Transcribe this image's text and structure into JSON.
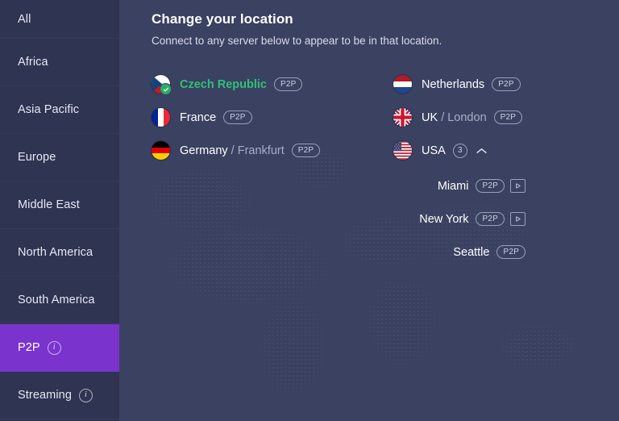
{
  "sidebar": {
    "items": [
      {
        "label": "All",
        "active": false,
        "info": false
      },
      {
        "label": "Africa",
        "active": false,
        "info": false
      },
      {
        "label": "Asia Pacific",
        "active": false,
        "info": false
      },
      {
        "label": "Europe",
        "active": false,
        "info": false
      },
      {
        "label": "Middle East",
        "active": false,
        "info": false
      },
      {
        "label": "North America",
        "active": false,
        "info": false
      },
      {
        "label": "South America",
        "active": false,
        "info": false
      },
      {
        "label": "P2P",
        "active": true,
        "info": true,
        "info_glyph": "i"
      },
      {
        "label": "Streaming",
        "active": false,
        "info": true,
        "info_glyph": "i"
      }
    ]
  },
  "main": {
    "title": "Change your location",
    "subtitle": "Connect to any server below to appear to be in that location.",
    "columns": [
      {
        "servers": [
          {
            "country": "Czech Republic",
            "city": "",
            "flag": "cz",
            "connected": true,
            "badges": [
              "P2P"
            ]
          },
          {
            "country": "France",
            "city": "",
            "flag": "fr",
            "connected": false,
            "badges": [
              "P2P"
            ]
          },
          {
            "country": "Germany",
            "city": "/ Frankfurt",
            "flag": "de",
            "connected": false,
            "badges": [
              "P2P"
            ]
          }
        ]
      },
      {
        "servers": [
          {
            "country": "Netherlands",
            "city": "",
            "flag": "nl",
            "connected": false,
            "badges": [
              "P2P"
            ]
          },
          {
            "country": "UK",
            "city": "/ London",
            "flag": "uk",
            "connected": false,
            "badges": [
              "P2P"
            ]
          },
          {
            "country": "USA",
            "city": "",
            "flag": "us",
            "connected": false,
            "count": "3",
            "expanded": true,
            "cities": [
              {
                "name": "Miami",
                "badges": [
                  "P2P",
                  "streaming"
                ]
              },
              {
                "name": "New York",
                "badges": [
                  "P2P",
                  "streaming"
                ]
              },
              {
                "name": "Seattle",
                "badges": [
                  "P2P"
                ]
              }
            ]
          }
        ]
      }
    ]
  },
  "colors": {
    "accent_purple": "#7a33cd",
    "connected_green": "#2fc177",
    "sidebar_bg": "#2e3451",
    "main_bg": "#3a4161",
    "badge_border": "#9aa0bc"
  },
  "labels": {
    "p2p": "P2P",
    "streaming_icon": "play-icon"
  }
}
